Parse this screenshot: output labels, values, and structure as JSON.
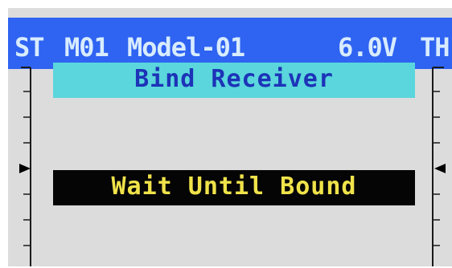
{
  "header": {
    "left_channel": "ST",
    "model_id": "M01",
    "model_name": "Model-01",
    "voltage": "6.0V",
    "right_channel": "TH"
  },
  "title": "Bind Receiver",
  "status": "Wait Until Bound",
  "colors": {
    "header_bg": "#2f63f2",
    "header_text": "#d8ecff",
    "title_bg": "#5ad6dc",
    "title_text": "#1d33b8",
    "status_bg": "#050505",
    "status_text": "#f0e34a",
    "screen_bg": "#dcdcdc"
  }
}
